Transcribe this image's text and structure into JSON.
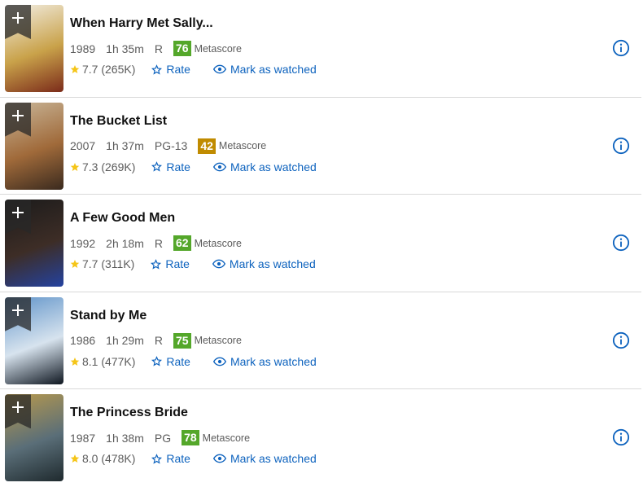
{
  "colors": {
    "accent": "#0e63be",
    "star": "#f5c518",
    "metascore_green": "#54a72a",
    "metascore_yellow": "#c08b00"
  },
  "labels": {
    "rate": "Rate",
    "mark_watched": "Mark as watched",
    "metascore": "Metascore"
  },
  "movies": [
    {
      "title": "When Harry Met Sally...",
      "year": "1989",
      "runtime": "1h 35m",
      "certificate": "R",
      "metascore": "76",
      "metascore_color": "#54a72a",
      "rating": "7.7",
      "votes": "(265K)",
      "poster_colors": [
        "#f3efe6",
        "#c9a24a",
        "#7b2b1a"
      ]
    },
    {
      "title": "The Bucket List",
      "year": "2007",
      "runtime": "1h 37m",
      "certificate": "PG-13",
      "metascore": "42",
      "metascore_color": "#c08b00",
      "rating": "7.3",
      "votes": "(269K)",
      "poster_colors": [
        "#c9b79a",
        "#a06a3a",
        "#3a2a1e"
      ]
    },
    {
      "title": "A Few Good Men",
      "year": "1992",
      "runtime": "2h 18m",
      "certificate": "R",
      "metascore": "62",
      "metascore_color": "#54a72a",
      "rating": "7.7",
      "votes": "(311K)",
      "poster_colors": [
        "#1b1b1b",
        "#3d2d26",
        "#2442a0"
      ]
    },
    {
      "title": "Stand by Me",
      "year": "1986",
      "runtime": "1h 29m",
      "certificate": "R",
      "metascore": "75",
      "metascore_color": "#54a72a",
      "rating": "8.1",
      "votes": "(477K)",
      "poster_colors": [
        "#5f93c9",
        "#d7e3ee",
        "#0e1620"
      ]
    },
    {
      "title": "The Princess Bride",
      "year": "1987",
      "runtime": "1h 38m",
      "certificate": "PG",
      "metascore": "78",
      "metascore_color": "#54a72a",
      "rating": "8.0",
      "votes": "(478K)",
      "poster_colors": [
        "#b99a4c",
        "#5a6e78",
        "#1f2a2e"
      ]
    }
  ]
}
